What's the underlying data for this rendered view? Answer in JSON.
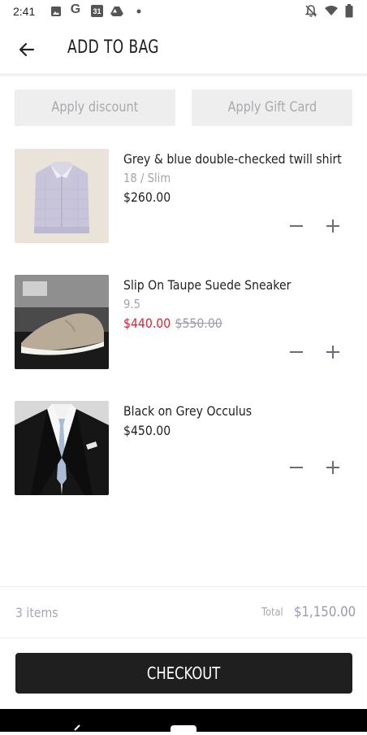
{
  "status_bar": {
    "time": "2:41",
    "icons_left": [
      "image-icon",
      "google-g-icon",
      "calendar-icon",
      "drive-icon",
      "dot-icon"
    ],
    "icons_right": [
      "notifications-off-icon",
      "wifi-icon",
      "battery-icon"
    ],
    "calendar_day": "31",
    "google_letter": "G"
  },
  "header": {
    "title": "ADD TO BAG"
  },
  "actions": {
    "discount_label": "Apply discount",
    "gift_card_label": "Apply Gift Card"
  },
  "items": [
    {
      "name": "Grey & blue double-checked twill shirt",
      "variant": "18 / Slim",
      "price": "$260.00"
    },
    {
      "name": "Slip On Taupe Suede Sneaker",
      "variant": "9.5",
      "sale_price": "$440.00",
      "original_price": "$550.00"
    },
    {
      "name": "Black on Grey Occulus",
      "price": "$450.00"
    }
  ],
  "summary": {
    "count": "3 items",
    "total_label": "Total",
    "total_value": "$1,150.00"
  },
  "checkout": {
    "label": "CHECKOUT"
  },
  "colors": {
    "accent": "#1f1f1f",
    "sale": "#e0212f",
    "muted": "#a6a6b6"
  }
}
